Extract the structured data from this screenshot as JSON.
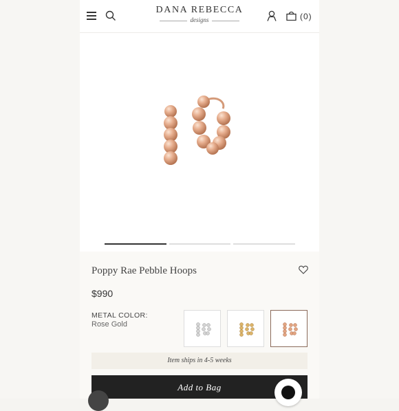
{
  "header": {
    "logo_main": "DANA REBECCA",
    "logo_sub": "designs",
    "bag_count": "(0)"
  },
  "product": {
    "title": "Poppy Rae Pebble Hoops",
    "price": "$990",
    "metal_label": "METAL COLOR:",
    "metal_value": "Rose Gold",
    "swatches": [
      {
        "name": "White Gold",
        "color": "#d8d8d8"
      },
      {
        "name": "Yellow Gold",
        "color": "#d9b26a"
      },
      {
        "name": "Rose Gold",
        "color": "#d9a07a",
        "selected": true
      }
    ],
    "shipping_note": "Item ships in 4-5 weeks",
    "add_to_bag": "Add to Bag"
  },
  "gallery": {
    "image_count": 3,
    "active_index": 0
  },
  "colors": {
    "rose_gold": "#e6ad8d",
    "button_dark": "#222222"
  }
}
